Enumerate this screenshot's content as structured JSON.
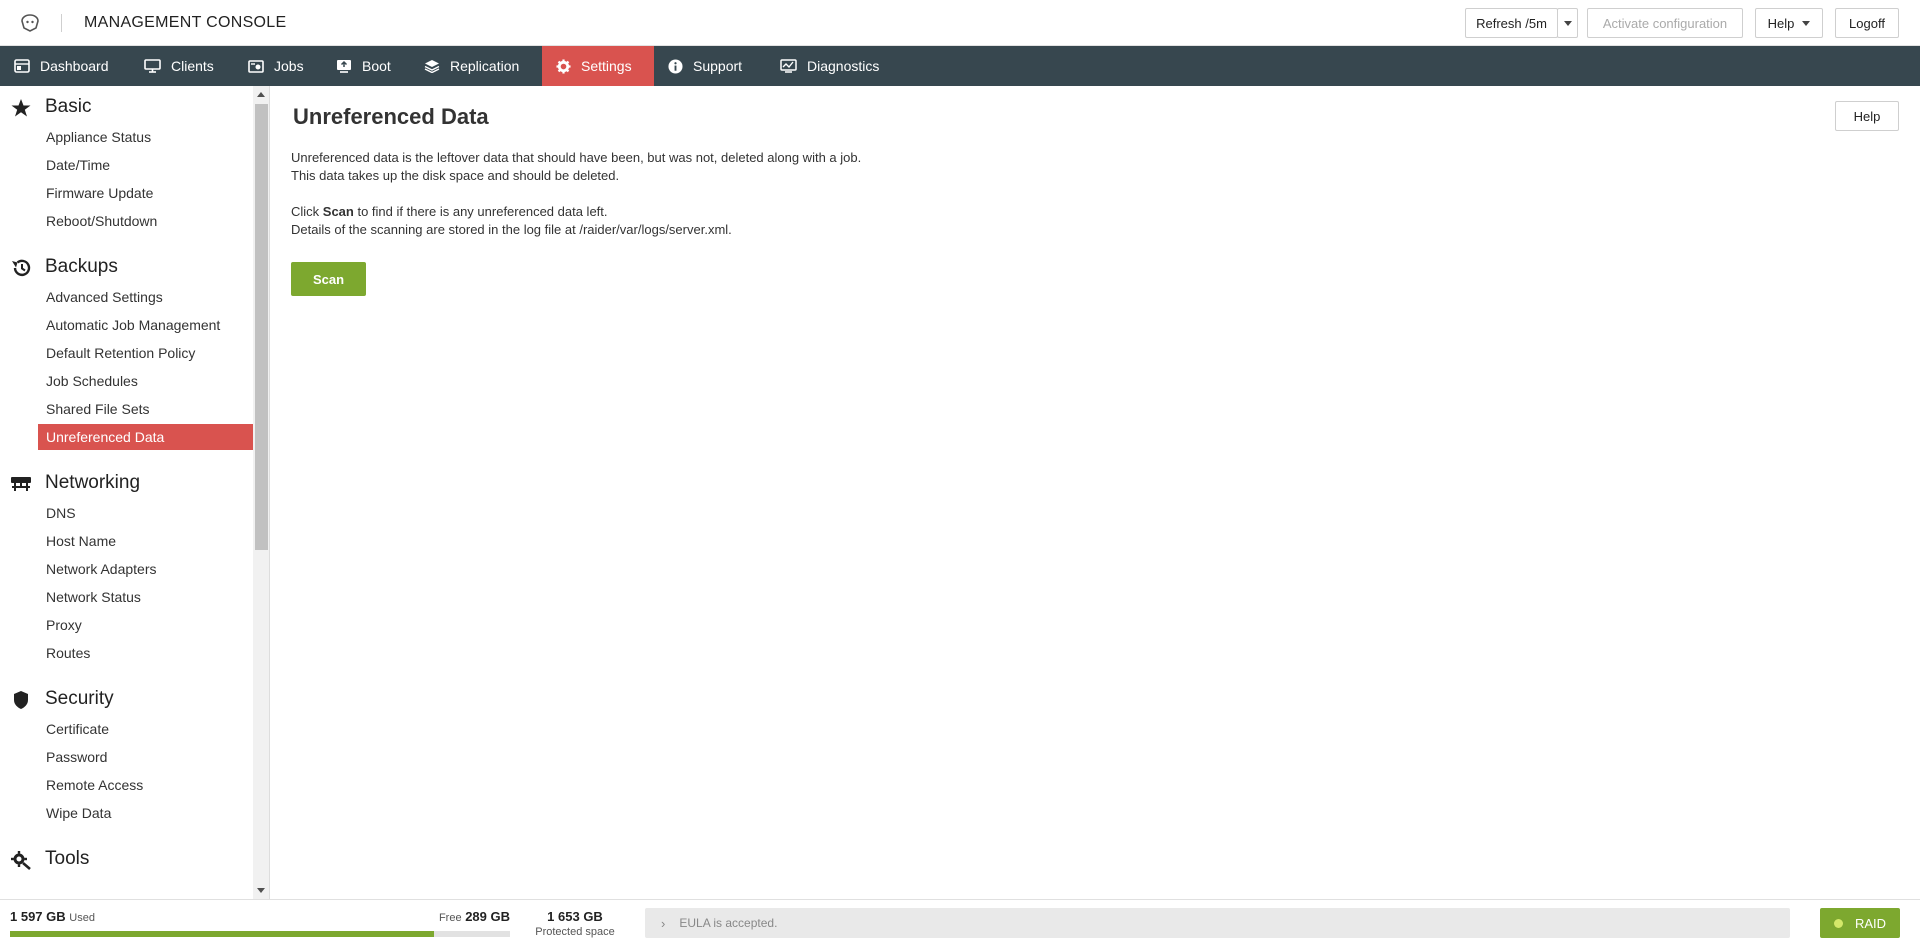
{
  "header": {
    "app_title": "MANAGEMENT CONSOLE",
    "refresh_label": "Refresh /5m",
    "activate_label": "Activate configuration",
    "help_label": "Help",
    "logoff_label": "Logoff"
  },
  "nav": {
    "items": [
      {
        "label": "Dashboard",
        "icon": "dashboard-icon"
      },
      {
        "label": "Clients",
        "icon": "monitor-icon"
      },
      {
        "label": "Jobs",
        "icon": "jobs-icon"
      },
      {
        "label": "Boot",
        "icon": "boot-icon"
      },
      {
        "label": "Replication",
        "icon": "replication-icon"
      },
      {
        "label": "Settings",
        "icon": "gear-icon",
        "active": true
      },
      {
        "label": "Support",
        "icon": "info-icon"
      },
      {
        "label": "Diagnostics",
        "icon": "diagnostics-icon"
      }
    ]
  },
  "sidebar": {
    "sections": [
      {
        "title": "Basic",
        "icon": "star-icon",
        "items": [
          "Appliance Status",
          "Date/Time",
          "Firmware Update",
          "Reboot/Shutdown"
        ]
      },
      {
        "title": "Backups",
        "icon": "history-icon",
        "items": [
          "Advanced Settings",
          "Automatic Job Management",
          "Default Retention Policy",
          "Job Schedules",
          "Shared File Sets",
          "Unreferenced Data"
        ]
      },
      {
        "title": "Networking",
        "icon": "network-icon",
        "items": [
          "DNS",
          "Host Name",
          "Network Adapters",
          "Network Status",
          "Proxy",
          "Routes"
        ]
      },
      {
        "title": "Security",
        "icon": "shield-icon",
        "items": [
          "Certificate",
          "Password",
          "Remote Access",
          "Wipe Data"
        ]
      },
      {
        "title": "Tools",
        "icon": "tools-icon",
        "items": []
      }
    ],
    "active_item": "Unreferenced Data"
  },
  "main": {
    "title": "Unreferenced Data",
    "help_label": "Help",
    "para1_line1": "Unreferenced data is the leftover data that should have been, but was not, deleted along with a job.",
    "para1_line2": "This data takes up the disk space and should be deleted.",
    "para2_prefix": "Click ",
    "para2_bold": "Scan",
    "para2_suffix": " to find if there is any unreferenced data left.",
    "para2_line2": "Details of the scanning are stored in the log file at /raider/var/logs/server.xml.",
    "scan_label": "Scan"
  },
  "footer": {
    "used_value": "1 597 GB",
    "used_label": "Used",
    "free_label": "Free",
    "free_value": "289 GB",
    "used_fraction": 0.847,
    "protected_value": "1 653 GB",
    "protected_label": "Protected space",
    "eula_text": "EULA is accepted.",
    "raid_label": "RAID"
  },
  "colors": {
    "nav_bg": "#37474f",
    "active": "#d9534f",
    "accent_green": "#7da82f"
  }
}
